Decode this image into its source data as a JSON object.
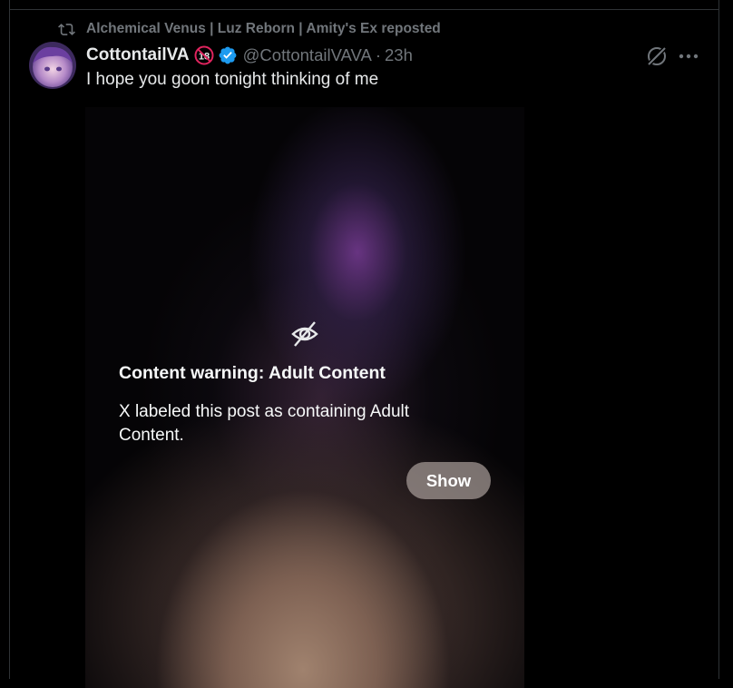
{
  "repost": {
    "text": "Alchemical Venus | Luz Reborn | Amity's Ex reposted",
    "icon": "repost-icon"
  },
  "author": {
    "display_name": "CottontailVA",
    "age_badge": "18",
    "handle": "@CottontailVAVA",
    "separator": "·",
    "time": "23h",
    "verified_color": "#1d9bf0"
  },
  "post": {
    "text": "I hope you goon tonight thinking of me"
  },
  "content_warning": {
    "title": "Content warning: Adult Content",
    "description": "X labeled this post as containing Adult Content.",
    "show_label": "Show",
    "icon": "eye-slash-icon"
  },
  "actions": {
    "grok_icon": "grok-icon",
    "more_icon": "more-icon"
  }
}
